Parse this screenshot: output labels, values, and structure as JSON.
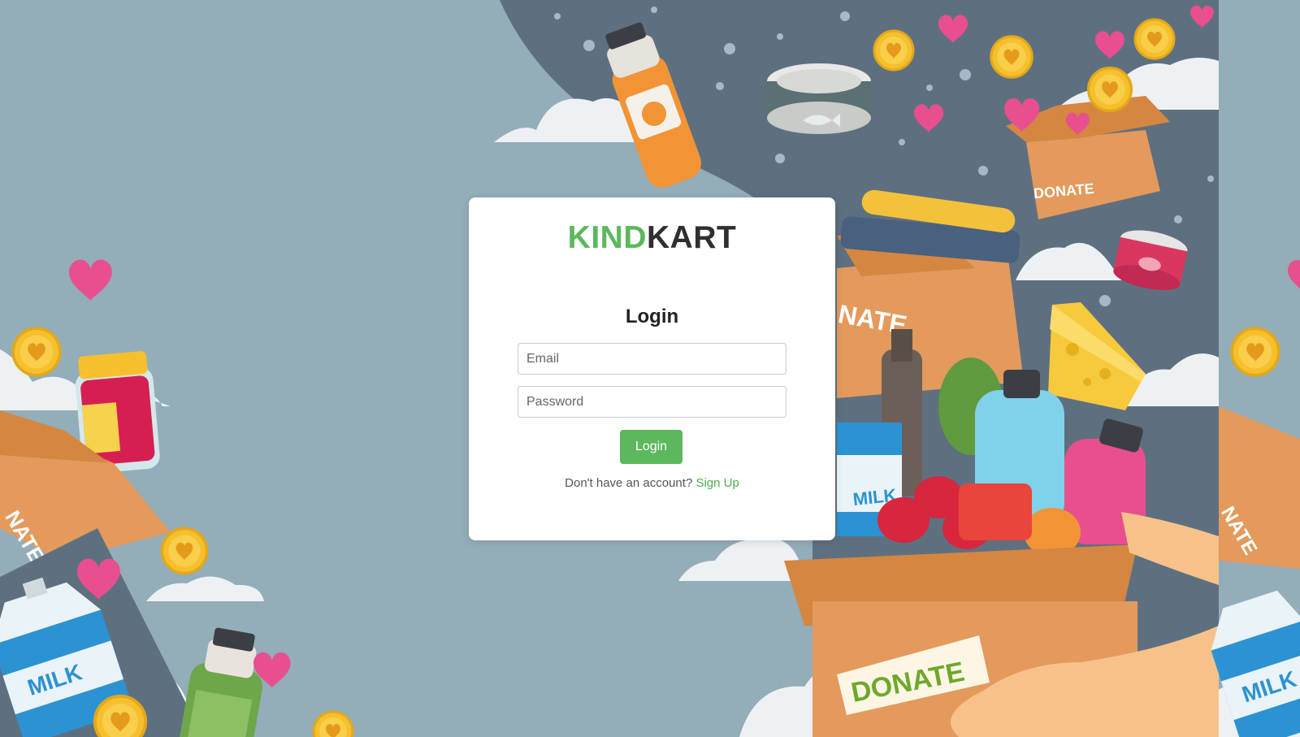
{
  "brand": {
    "part1": "KIND",
    "part2": "KART"
  },
  "form": {
    "title": "Login",
    "email_placeholder": "Email",
    "password_placeholder": "Password",
    "submit_label": "Login",
    "signup_prompt": "Don't have an account?",
    "signup_link": "Sign Up"
  },
  "illustration": {
    "labels": {
      "donate": "DONATE",
      "milk": "MILK",
      "nate": "NATE"
    },
    "icons": [
      "heart-icon",
      "coin-icon",
      "cloud-icon",
      "donation-box-icon",
      "bottle-icon",
      "can-icon",
      "cheese-icon",
      "milk-carton-icon"
    ]
  },
  "colors": {
    "accent": "#5cb85c",
    "background": "#93adb9",
    "dark_panel": "#5e7080",
    "box": "#e39a5c",
    "heart": "#e84f8f",
    "coin": "#f6c02d"
  }
}
